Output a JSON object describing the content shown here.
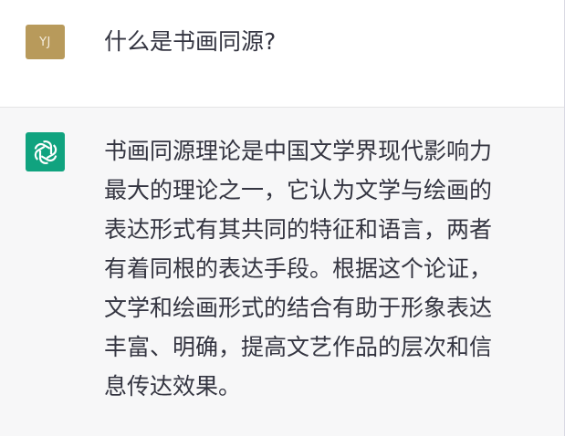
{
  "conversation": {
    "user": {
      "avatar_initials": "YJ",
      "avatar_color": "#b89a5b",
      "message": "什么是书画同源?"
    },
    "assistant": {
      "avatar_icon": "openai-logo-icon",
      "avatar_color": "#10a37f",
      "message_lines": [
        "书画同源理论是中国文学界现代影响力",
        "最大的理论之一，它认为文学与绘画的",
        "表达形式有其共同的特征和语言，两者",
        "有着同根的表达手段。根据这个论证，",
        "文学和绘画形式的结合有助于形象表达",
        "丰富、明确，提高文艺作品的层次和信",
        "息传达效果。"
      ]
    }
  }
}
